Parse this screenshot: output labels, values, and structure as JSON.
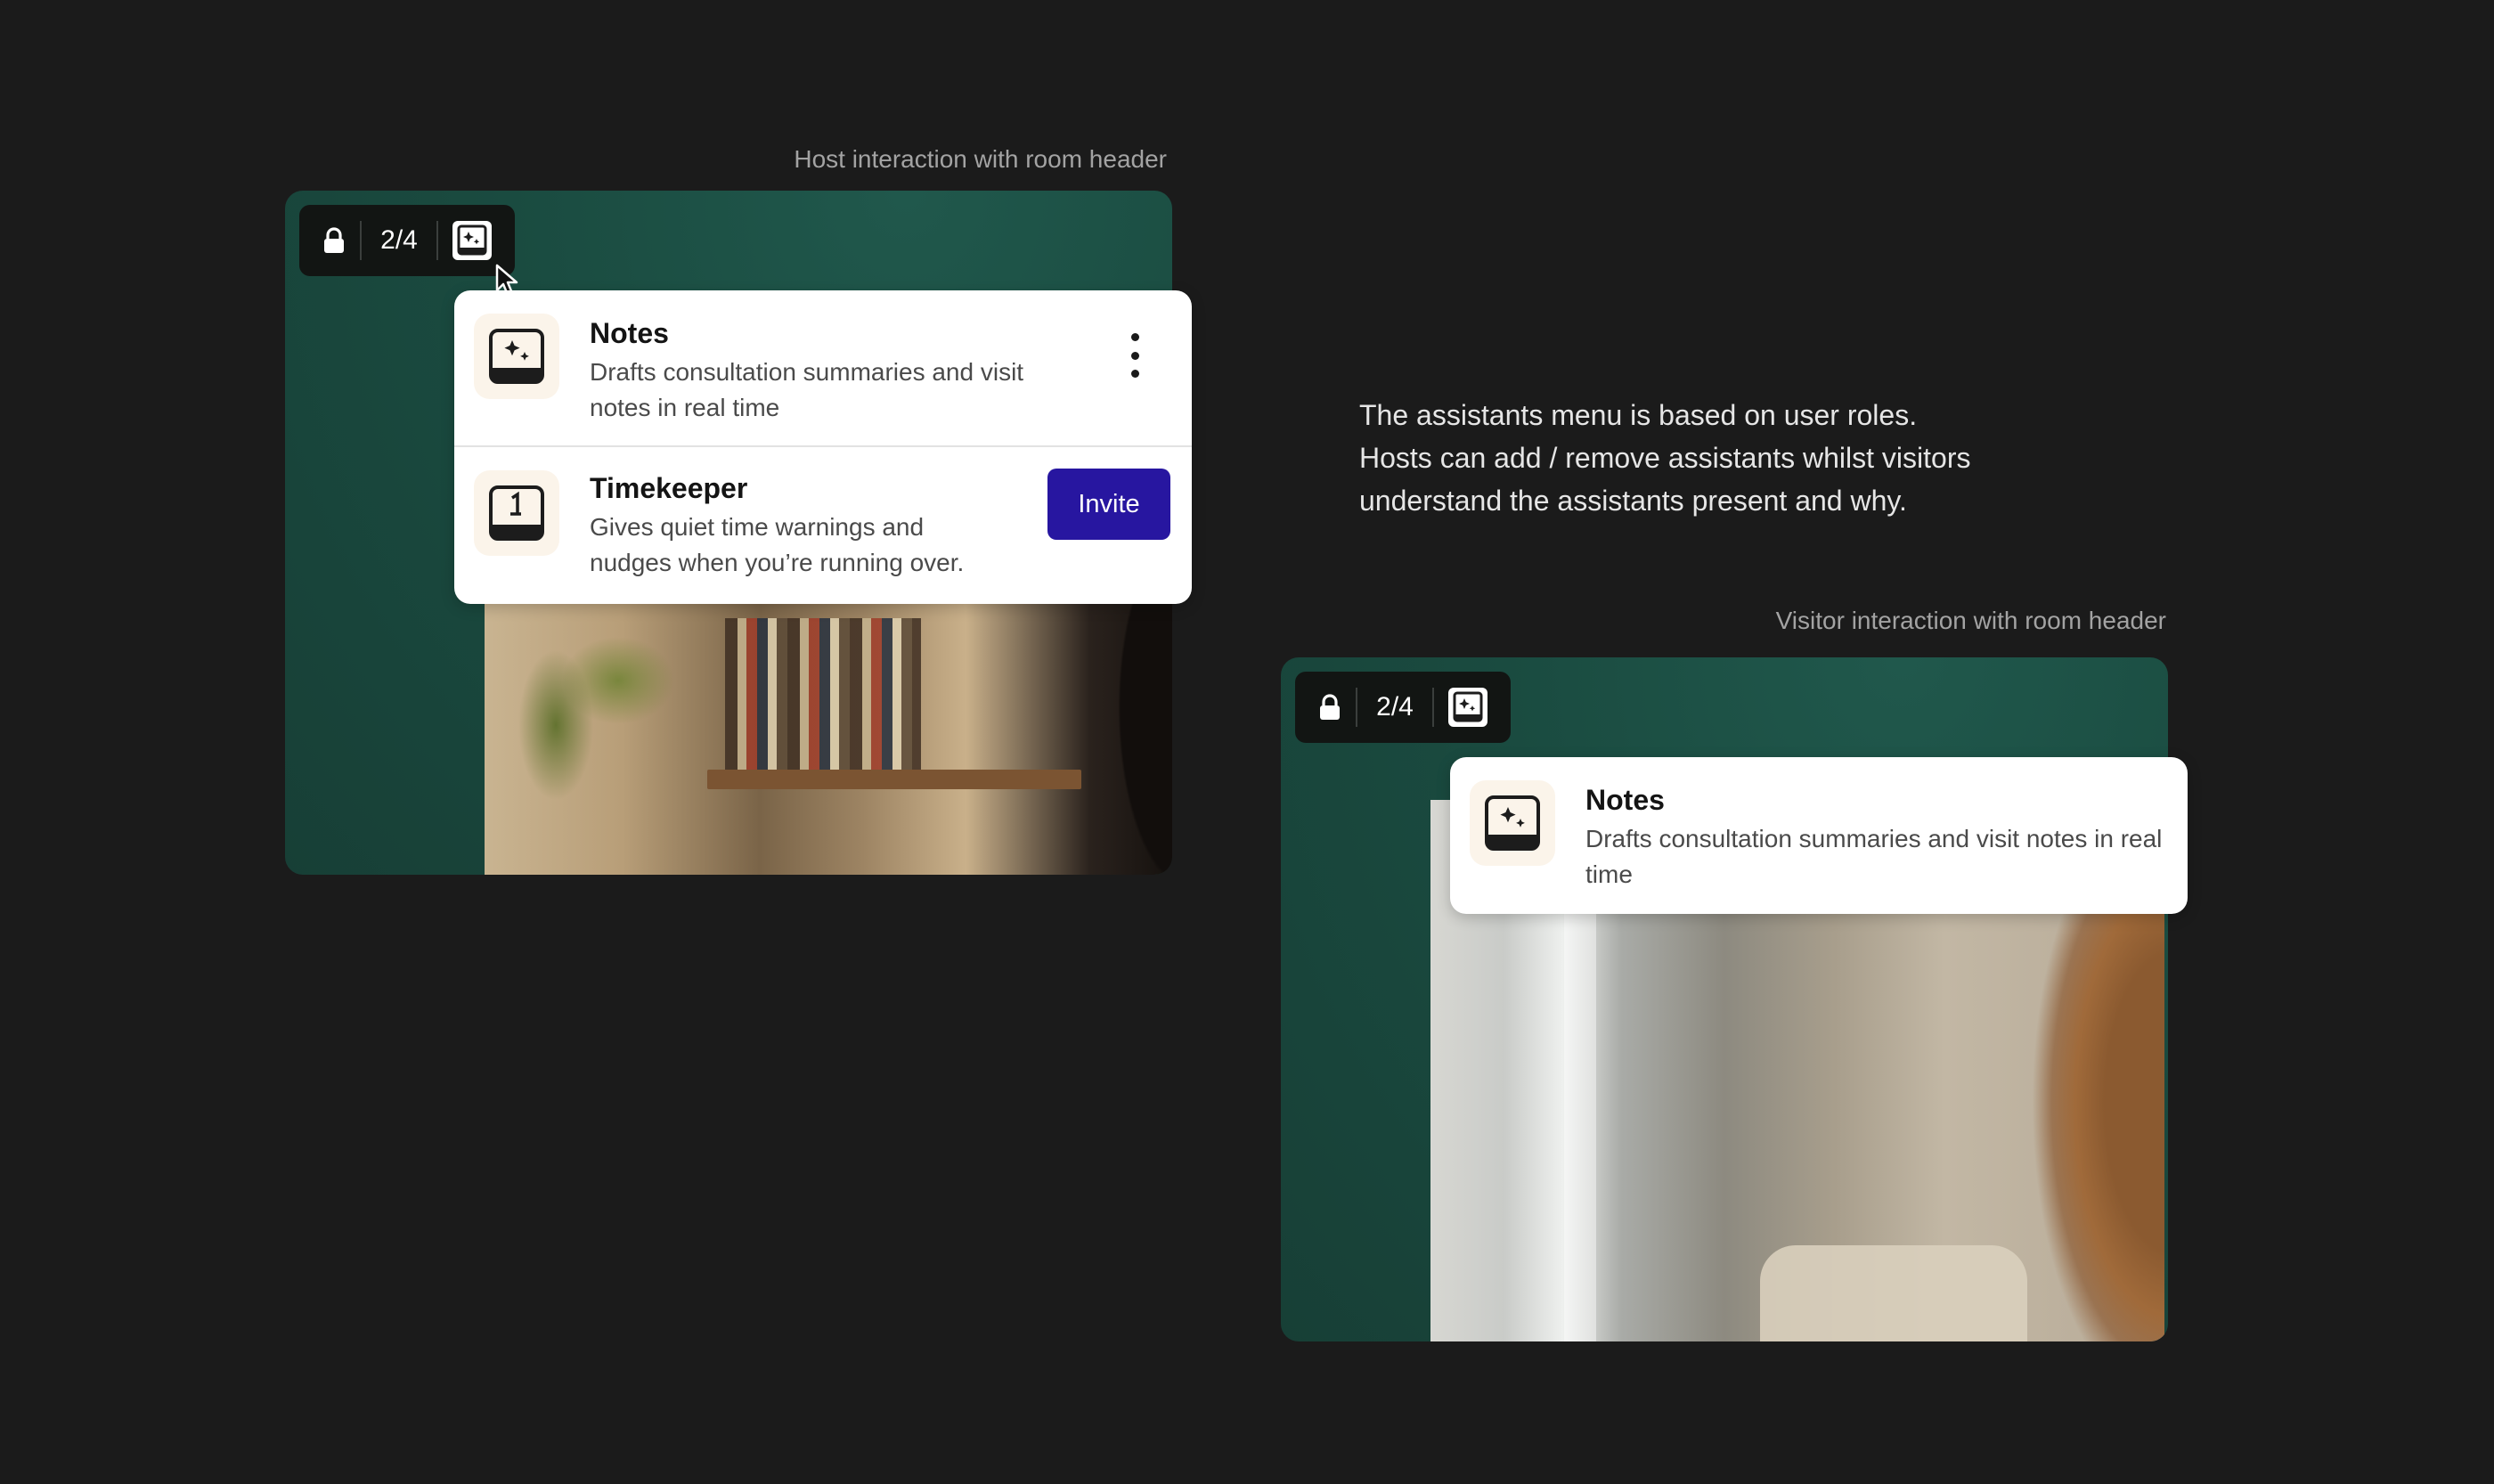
{
  "host_panel": {
    "caption": "Host interaction with room header",
    "toolbar": {
      "lock_icon": "lock-icon",
      "participants": "2/4",
      "assistants_icon": "ai-assistant-icon"
    },
    "assistants": [
      {
        "name": "Notes",
        "description": "Drafts consultation summaries and visit notes in real time",
        "icon": "notes-sparkle-icon",
        "action_icon": "more-vertical-icon"
      },
      {
        "name": "Timekeeper",
        "description": "Gives quiet time warnings and nudges when you’re running over.",
        "icon": "timekeeper-icon",
        "action_label": "Invite"
      }
    ]
  },
  "description": {
    "line1": "The assistants menu is based on user roles.",
    "line2": "Hosts can add / remove assistants whilst visitors",
    "line3": "understand the assistants present and why."
  },
  "visitor_panel": {
    "caption": "Visitor interaction with room header",
    "toolbar": {
      "lock_icon": "lock-icon",
      "participants": "2/4",
      "assistants_icon": "ai-assistant-icon"
    },
    "assistants": [
      {
        "name": "Notes",
        "description": "Drafts consultation summaries and visit notes in real time",
        "icon": "notes-sparkle-icon"
      }
    ]
  },
  "colors": {
    "page_background": "#1b1b1b",
    "room_background": "#1a4b40",
    "invite_button": "#2716a0",
    "toolbar_background": "#121513"
  }
}
